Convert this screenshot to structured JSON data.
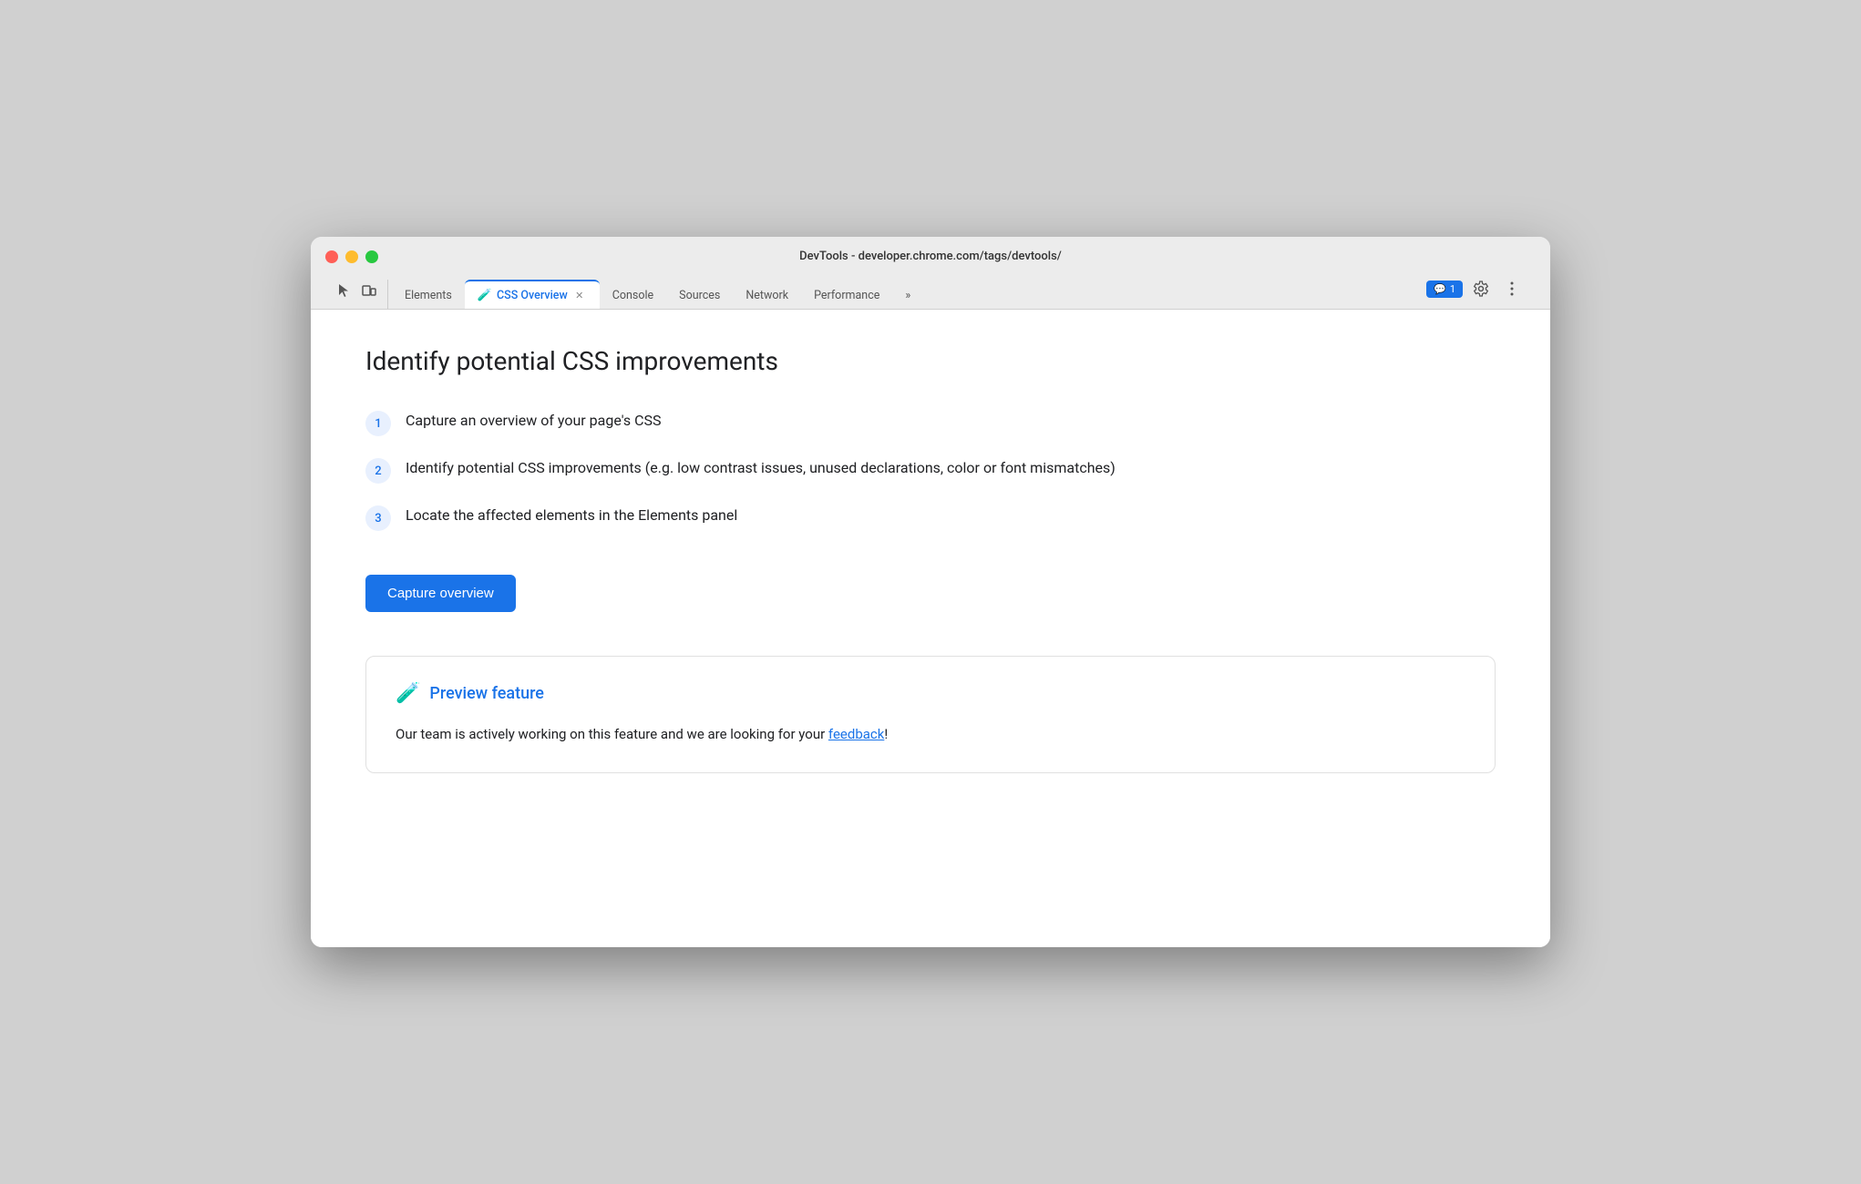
{
  "window": {
    "title": "DevTools - developer.chrome.com/tags/devtools/"
  },
  "tabs": [
    {
      "id": "elements",
      "label": "Elements",
      "active": false,
      "closeable": false
    },
    {
      "id": "css-overview",
      "label": "CSS Overview",
      "active": true,
      "closeable": true,
      "hasFlask": true
    },
    {
      "id": "console",
      "label": "Console",
      "active": false,
      "closeable": false
    },
    {
      "id": "sources",
      "label": "Sources",
      "active": false,
      "closeable": false
    },
    {
      "id": "network",
      "label": "Network",
      "active": false,
      "closeable": false
    },
    {
      "id": "performance",
      "label": "Performance",
      "active": false,
      "closeable": false
    },
    {
      "id": "more",
      "label": "»",
      "active": false,
      "closeable": false
    }
  ],
  "notifications": {
    "icon": "💬",
    "count": "1"
  },
  "main": {
    "page_title": "Identify potential CSS improvements",
    "steps": [
      {
        "number": "1",
        "text": "Capture an overview of your page's CSS"
      },
      {
        "number": "2",
        "text": "Identify potential CSS improvements (e.g. low contrast issues, unused declarations, color or font mismatches)"
      },
      {
        "number": "3",
        "text": "Locate the affected elements in the Elements panel"
      }
    ],
    "capture_button": "Capture overview",
    "preview_section": {
      "title": "Preview feature",
      "description_before": "Our team is actively working on this feature and we are looking for your ",
      "link_text": "feedback",
      "description_after": "!"
    }
  }
}
